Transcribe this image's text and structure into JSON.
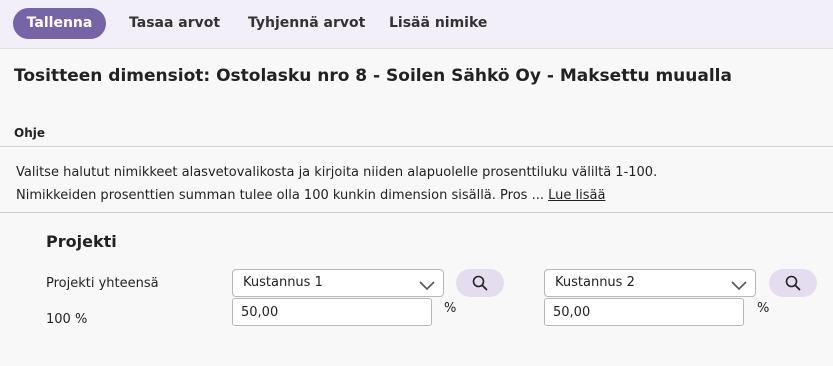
{
  "toolbar": {
    "buttons": [
      {
        "label": "Tallenna"
      },
      {
        "label": "Tasaa arvot"
      },
      {
        "label": "Tyhjennä arvot"
      },
      {
        "label": "Lisää nimike"
      }
    ]
  },
  "page": {
    "title": "Tositteen dimensiot: Ostolasku nro 8 - Soilen Sähkö Oy - Maksettu muualla"
  },
  "help": {
    "heading": "Ohje",
    "line1": "Valitse halutut nimikkeet alasvetovalikosta ja kirjoita niiden alapuolelle prosenttiluku väliltä 1-100.",
    "line2": "Nimikkeiden prosenttien summan tulee olla 100 kunkin dimension sisällä. Pros ...",
    "read_more": "Lue lisää"
  },
  "section": {
    "title": "Projekti",
    "total_label": "Projekti yhteensä",
    "total_value": "100 %",
    "dimensions": [
      {
        "selected": "Kustannus 1",
        "percent": "50,00",
        "unit": "%",
        "icon": "search-icon"
      },
      {
        "selected": "Kustannus 2",
        "percent": "50,00",
        "unit": "%",
        "icon": "search-icon"
      }
    ]
  },
  "colors": {
    "primary": "#7565a6",
    "toolbar_bg": "#f3eff8",
    "search_button_bg": "#e4ddef"
  }
}
